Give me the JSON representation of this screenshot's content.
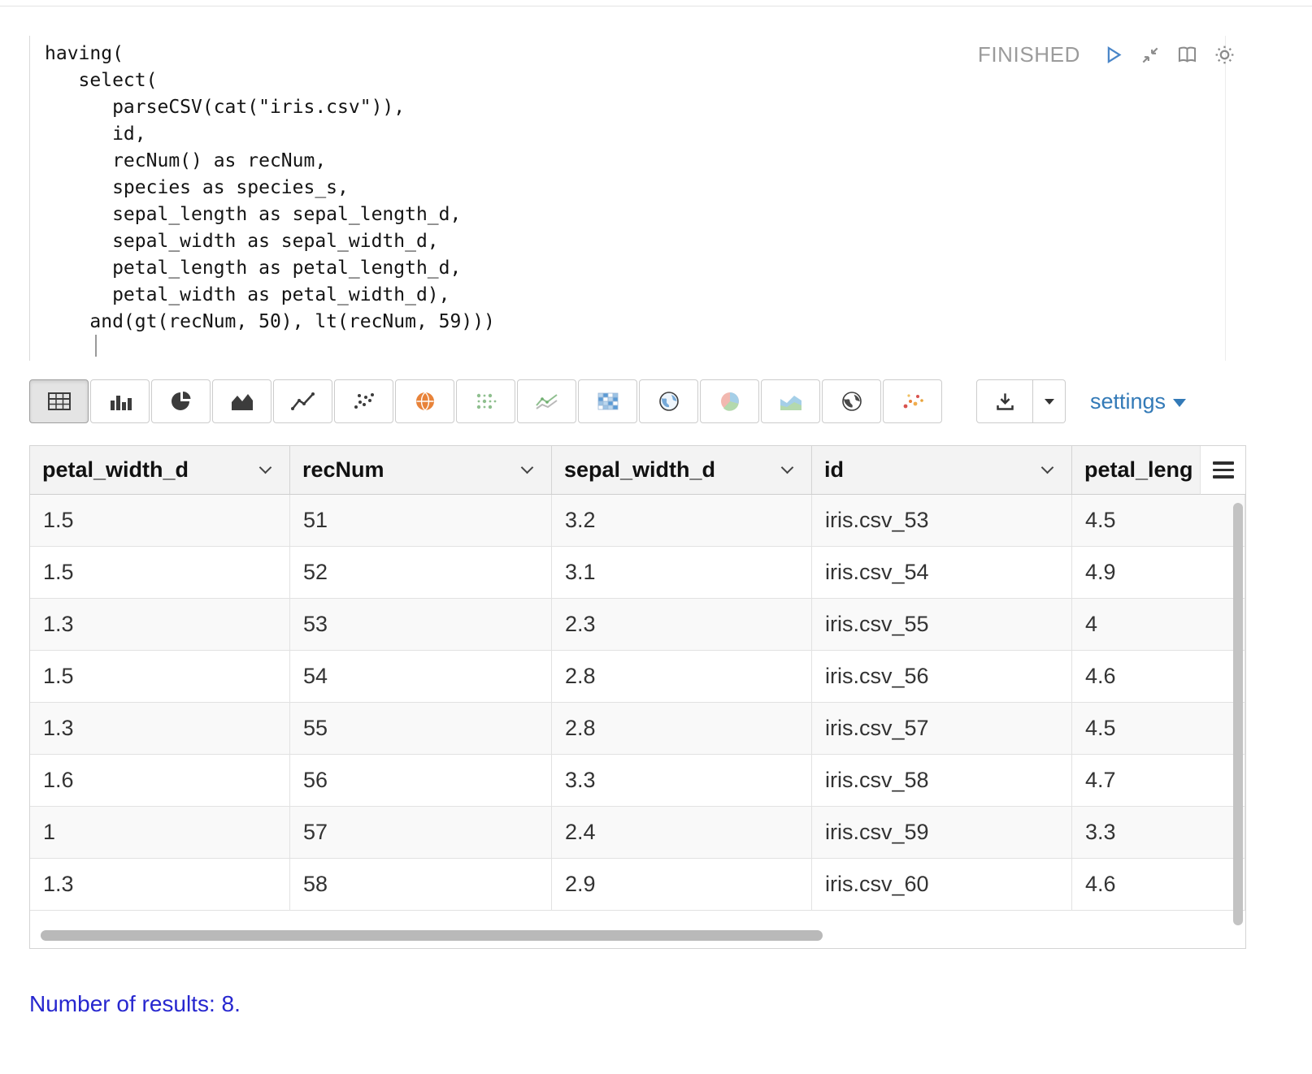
{
  "editor": {
    "status": "FINISHED",
    "code_lines": [
      "having(",
      "   select(",
      "      parseCSV(cat(\"iris.csv\")),",
      "      id,",
      "      recNum() as recNum,",
      "      species as species_s,",
      "      sepal_length as sepal_length_d,",
      "      sepal_width as sepal_width_d,",
      "      petal_length as petal_length_d,",
      "      petal_width as petal_width_d),",
      "    and(gt(recNum, 50), lt(recNum, 59)))"
    ],
    "actions": [
      "run",
      "shrink-editor",
      "show-output",
      "paragraph-settings"
    ]
  },
  "viz_toolbar": {
    "chart_types": [
      "table",
      "multibar-chart",
      "pie-chart",
      "area-chart",
      "line-chart",
      "scatter-chart",
      "map",
      "bubble-grid",
      "spark-lines",
      "heatmap",
      "geo-map",
      "pie-chart-alt",
      "stacked-area",
      "world-map",
      "color-scatter"
    ],
    "active_chart": "table",
    "settings_label": "settings"
  },
  "table": {
    "columns": [
      "petal_width_d",
      "recNum",
      "sepal_width_d",
      "id",
      "petal_leng"
    ],
    "rows": [
      [
        "1.5",
        "51",
        "3.2",
        "iris.csv_53",
        "4.5"
      ],
      [
        "1.5",
        "52",
        "3.1",
        "iris.csv_54",
        "4.9"
      ],
      [
        "1.3",
        "53",
        "2.3",
        "iris.csv_55",
        "4"
      ],
      [
        "1.5",
        "54",
        "2.8",
        "iris.csv_56",
        "4.6"
      ],
      [
        "1.3",
        "55",
        "2.8",
        "iris.csv_57",
        "4.5"
      ],
      [
        "1.6",
        "56",
        "3.3",
        "iris.csv_58",
        "4.7"
      ],
      [
        "1",
        "57",
        "2.4",
        "iris.csv_59",
        "3.3"
      ],
      [
        "1.3",
        "58",
        "2.9",
        "iris.csv_60",
        "4.6"
      ]
    ]
  },
  "footer": {
    "text": "Number of results: 8."
  },
  "colors": {
    "accent_blue": "#337ab7",
    "link_blue": "#2727cf",
    "status_gray": "#9b9b9b",
    "icon_dark": "#3c3c3c"
  }
}
